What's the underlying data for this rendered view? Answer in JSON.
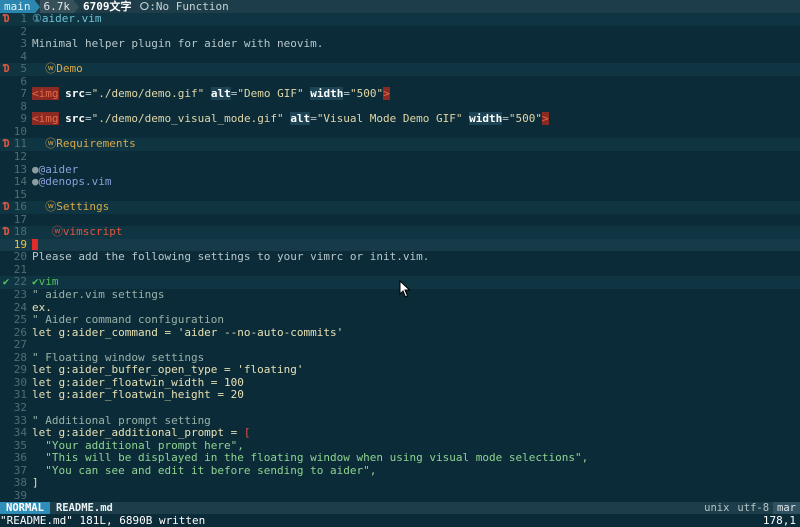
{
  "tabline": {
    "branch": "main",
    "size": "6.7k",
    "words": "6709文字",
    "function": "ⵔ:No Function"
  },
  "lines": [
    {
      "n": "1",
      "sign": "fold",
      "parts": [
        {
          "c": "h-title",
          "t": "①aider.vim"
        }
      ],
      "band": true
    },
    {
      "n": "2",
      "parts": []
    },
    {
      "n": "3",
      "parts": [
        {
          "c": "plain",
          "t": "Minimal helper plugin for aider with neovim."
        }
      ]
    },
    {
      "n": "4",
      "parts": []
    },
    {
      "n": "5",
      "sign": "fold",
      "parts": [
        {
          "c": "h-sec",
          "t": "  ⓦDemo"
        }
      ],
      "band": true
    },
    {
      "n": "6",
      "parts": []
    },
    {
      "n": "7",
      "parts": [
        {
          "c": "tag-img",
          "t": "<img"
        },
        {
          "c": "plain",
          "t": " "
        },
        {
          "c": "attr",
          "t": "src"
        },
        {
          "c": "plain",
          "t": "="
        },
        {
          "c": "str",
          "t": "\"./demo/demo.gif\""
        },
        {
          "c": "plain",
          "t": " "
        },
        {
          "c": "attr-hl",
          "t": "alt"
        },
        {
          "c": "plain",
          "t": "="
        },
        {
          "c": "str",
          "t": "\"Demo GIF\""
        },
        {
          "c": "plain",
          "t": " "
        },
        {
          "c": "attr-hl",
          "t": "width"
        },
        {
          "c": "plain",
          "t": "="
        },
        {
          "c": "str",
          "t": "\"500\""
        },
        {
          "c": "tag-img",
          "t": ">"
        }
      ]
    },
    {
      "n": "8",
      "parts": []
    },
    {
      "n": "9",
      "parts": [
        {
          "c": "tag-img",
          "t": "<img"
        },
        {
          "c": "plain",
          "t": " "
        },
        {
          "c": "attr",
          "t": "src"
        },
        {
          "c": "plain",
          "t": "="
        },
        {
          "c": "str",
          "t": "\"./demo/demo_visual_mode.gif\""
        },
        {
          "c": "plain",
          "t": " "
        },
        {
          "c": "attr-hl",
          "t": "alt"
        },
        {
          "c": "plain",
          "t": "="
        },
        {
          "c": "str",
          "t": "\"Visual Mode Demo GIF\""
        },
        {
          "c": "plain",
          "t": " "
        },
        {
          "c": "attr-hl",
          "t": "width"
        },
        {
          "c": "plain",
          "t": "="
        },
        {
          "c": "str",
          "t": "\"500\""
        },
        {
          "c": "tag-img",
          "t": ">"
        }
      ]
    },
    {
      "n": "10",
      "parts": []
    },
    {
      "n": "11",
      "sign": "fold",
      "parts": [
        {
          "c": "h-sec",
          "t": "  ⓦRequirements"
        }
      ],
      "band": true
    },
    {
      "n": "12",
      "parts": []
    },
    {
      "n": "13",
      "parts": [
        {
          "c": "list-bullet",
          "t": "●"
        },
        {
          "c": "list-link",
          "t": "@aider"
        }
      ]
    },
    {
      "n": "14",
      "parts": [
        {
          "c": "list-bullet",
          "t": "●"
        },
        {
          "c": "list-link",
          "t": "@denops.vim"
        }
      ]
    },
    {
      "n": "15",
      "parts": []
    },
    {
      "n": "16",
      "sign": "fold",
      "parts": [
        {
          "c": "h-sec",
          "t": "  ⓦSettings"
        }
      ],
      "band": true
    },
    {
      "n": "17",
      "parts": []
    },
    {
      "n": "18",
      "sign": "fold",
      "parts": [
        {
          "c": "h-vim",
          "t": "   ⓦvimscript"
        }
      ],
      "band": true
    },
    {
      "n": "19",
      "cursor": true,
      "parts": []
    },
    {
      "n": "20",
      "parts": [
        {
          "c": "plain",
          "t": "Please add the following settings to your vimrc or init.vim."
        }
      ]
    },
    {
      "n": "21",
      "parts": []
    },
    {
      "n": "22",
      "sign": "check",
      "parts": [
        {
          "c": "ok",
          "t": "✔vim"
        }
      ],
      "band": true
    },
    {
      "n": "23",
      "parts": [
        {
          "c": "comment",
          "t": "\" aider.vim settings"
        }
      ]
    },
    {
      "n": "24",
      "parts": [
        {
          "c": "code",
          "t": "ex."
        }
      ]
    },
    {
      "n": "25",
      "parts": [
        {
          "c": "comment",
          "t": "\" Aider command configuration"
        }
      ]
    },
    {
      "n": "26",
      "parts": [
        {
          "c": "code",
          "t": "let g:aider_command = 'aider --no-auto-commits'"
        }
      ]
    },
    {
      "n": "27",
      "parts": []
    },
    {
      "n": "28",
      "parts": [
        {
          "c": "comment",
          "t": "\" Floating window settings"
        }
      ]
    },
    {
      "n": "29",
      "parts": [
        {
          "c": "code",
          "t": "let g:aider_buffer_open_type = 'floating'"
        }
      ]
    },
    {
      "n": "30",
      "parts": [
        {
          "c": "code",
          "t": "let g:aider_floatwin_width = 100"
        }
      ]
    },
    {
      "n": "31",
      "parts": [
        {
          "c": "code",
          "t": "let g:aider_floatwin_height = 20"
        }
      ]
    },
    {
      "n": "32",
      "parts": []
    },
    {
      "n": "33",
      "parts": [
        {
          "c": "comment",
          "t": "\" Additional prompt setting"
        }
      ]
    },
    {
      "n": "34",
      "parts": [
        {
          "c": "code",
          "t": "let g:aider_additional_prompt = "
        },
        {
          "c": "h-vim",
          "t": "["
        }
      ]
    },
    {
      "n": "35",
      "parts": [
        {
          "c": "lead-str",
          "t": "  \"Your additional prompt here\","
        }
      ]
    },
    {
      "n": "36",
      "parts": [
        {
          "c": "lead-str",
          "t": "  \"This will be displayed in the floating window when using visual mode selections\","
        }
      ]
    },
    {
      "n": "37",
      "parts": [
        {
          "c": "lead-str",
          "t": "  \"You can see and edit it before sending to aider\","
        }
      ]
    },
    {
      "n": "38",
      "parts": [
        {
          "c": "code",
          "t": "]"
        }
      ]
    },
    {
      "n": "39",
      "parts": []
    }
  ],
  "statusline": {
    "mode": "NORMAL",
    "filename": "README.md",
    "fileformat": "unix",
    "encoding": "utf-8",
    "filetype": "mar"
  },
  "message": {
    "text": "\"README.md\" 181L, 6890B written",
    "position": "178,1"
  },
  "colors": {
    "background": "#0b2b38",
    "accent": "#2f8eb9",
    "fold": "#e0553e"
  }
}
